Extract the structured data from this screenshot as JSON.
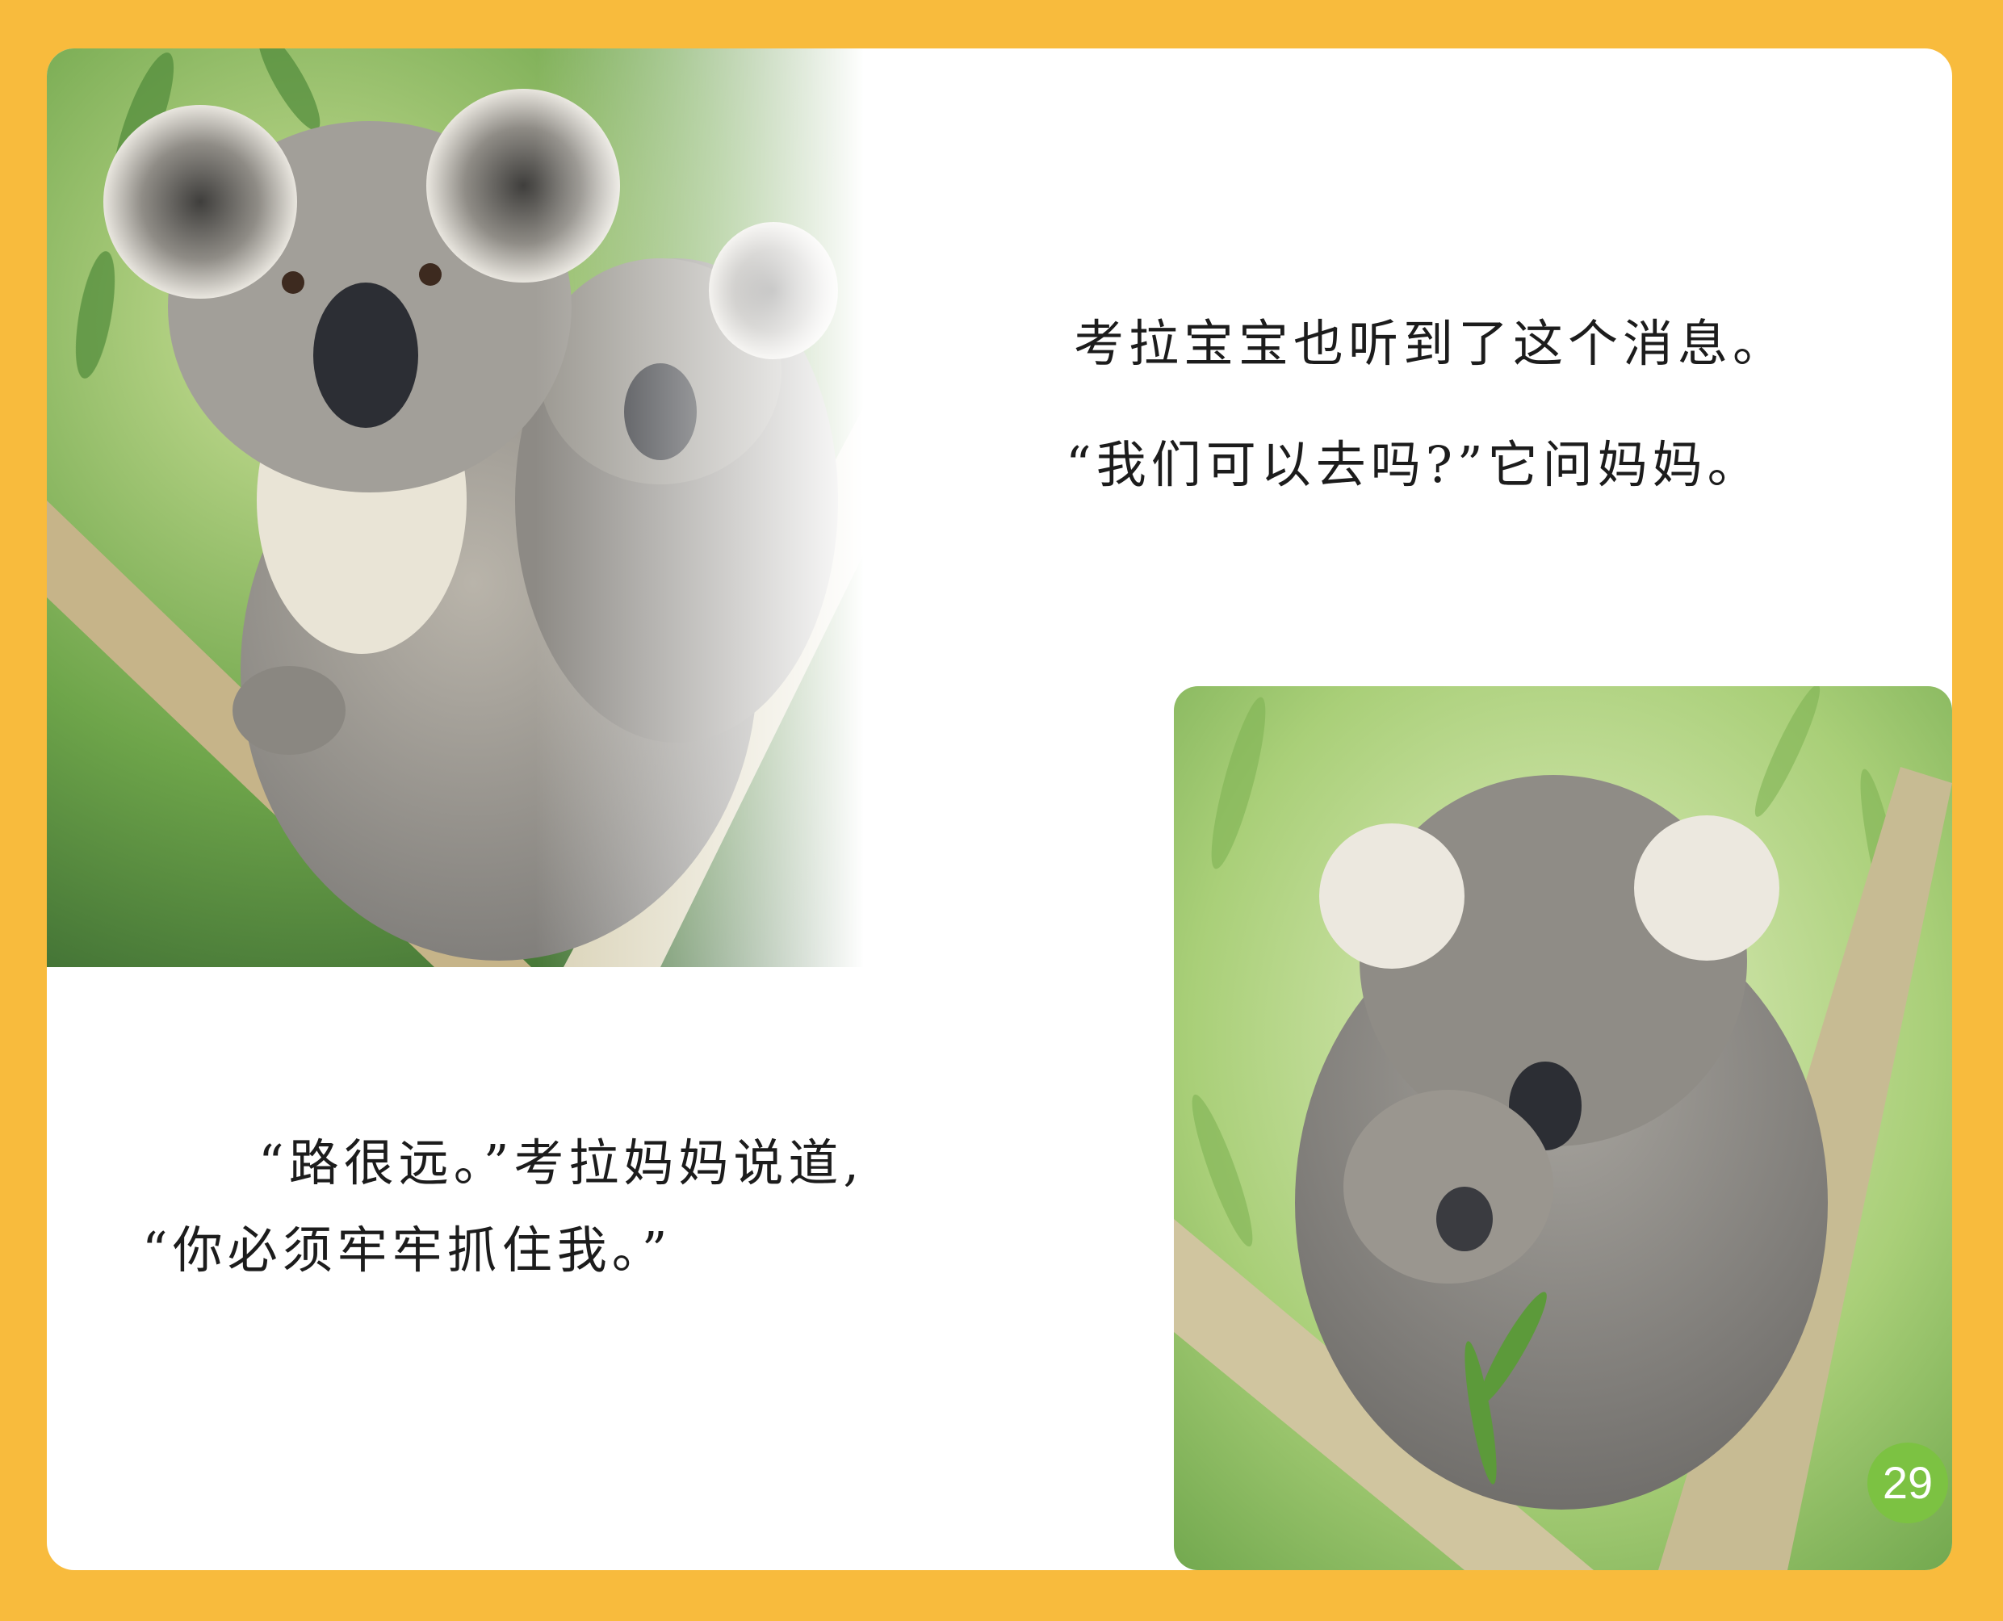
{
  "story": {
    "line_1": "考拉宝宝也听到了这个消息。",
    "line_2": "“我们可以去吗?”它问妈妈。",
    "line_3": "“路很远。”考拉妈妈说道,",
    "line_4": "“你必须牢牢抓住我。”"
  },
  "page_number": "29",
  "colors": {
    "frame": "#f8bb3d",
    "page": "#ffffff",
    "page_number_badge": "#7cc242"
  },
  "images": [
    {
      "name": "koala-mother-with-baby-on-back",
      "description_icon": "photo-icon"
    },
    {
      "name": "koala-mother-hugging-baby",
      "description_icon": "photo-icon"
    }
  ]
}
